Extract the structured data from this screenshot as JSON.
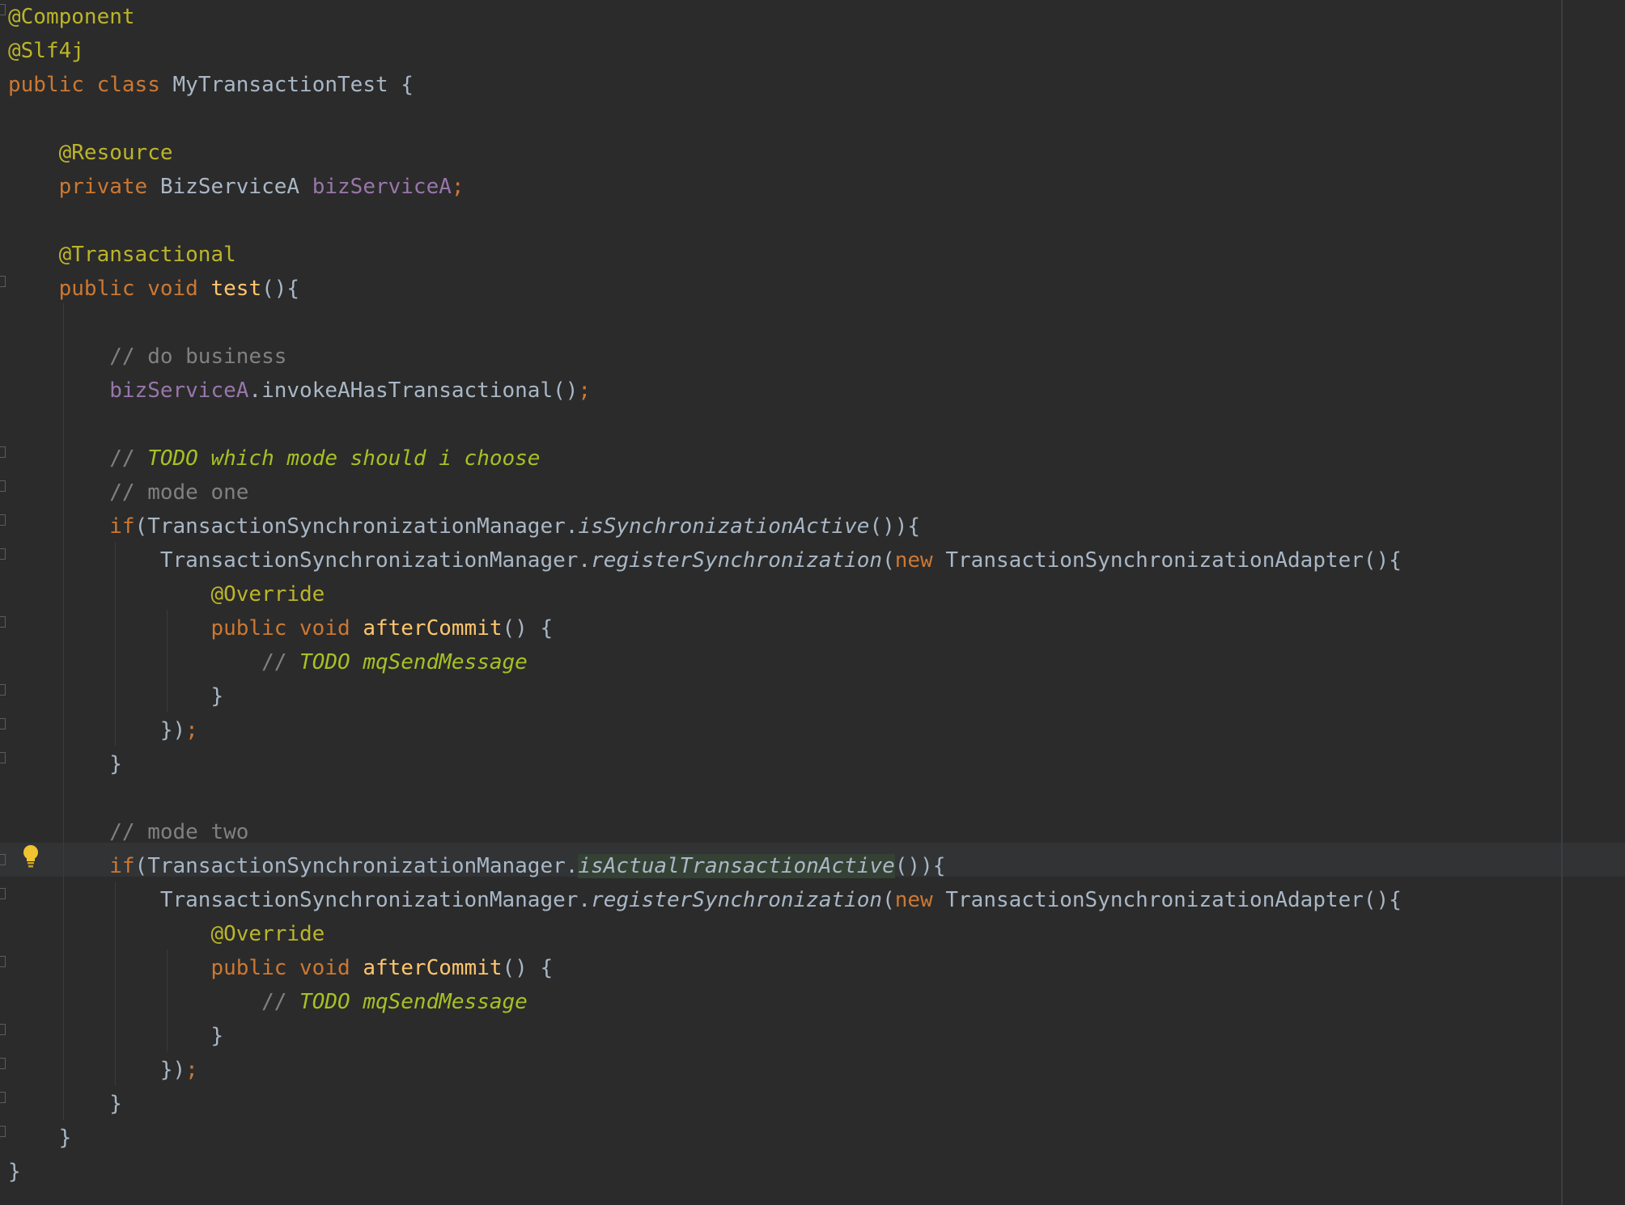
{
  "editor": {
    "language": "java",
    "theme": {
      "background": "#2b2b2b",
      "text": "#a9b7c6",
      "keyword": "#cc7832",
      "annotation": "#bbb529",
      "field": "#9876aa",
      "method_decl": "#ffc66d",
      "comment": "#808080",
      "todo": "#a8c023",
      "current_line": "#313335",
      "usage_highlight": "#344134"
    },
    "gutter_icons": [
      "fold-marker-icon",
      "lightbulb-icon"
    ],
    "lines": [
      {
        "tokens": [
          {
            "t": "@Component",
            "c": "ann"
          }
        ]
      },
      {
        "tokens": [
          {
            "t": "@Slf4j",
            "c": "ann"
          }
        ]
      },
      {
        "tokens": [
          {
            "t": "public",
            "c": "kw"
          },
          {
            "t": " "
          },
          {
            "t": "class",
            "c": "kw"
          },
          {
            "t": " MyTransactionTest {"
          }
        ]
      },
      {
        "tokens": []
      },
      {
        "tokens": [
          {
            "t": "    "
          },
          {
            "t": "@Resource",
            "c": "ann"
          }
        ]
      },
      {
        "tokens": [
          {
            "t": "    "
          },
          {
            "t": "private",
            "c": "kw"
          },
          {
            "t": " BizServiceA "
          },
          {
            "t": "bizServiceA",
            "c": "fld"
          },
          {
            "t": ";",
            "c": "kw"
          }
        ]
      },
      {
        "tokens": []
      },
      {
        "tokens": [
          {
            "t": "    "
          },
          {
            "t": "@Transactional",
            "c": "ann"
          }
        ]
      },
      {
        "tokens": [
          {
            "t": "    "
          },
          {
            "t": "public",
            "c": "kw"
          },
          {
            "t": " "
          },
          {
            "t": "void",
            "c": "kw"
          },
          {
            "t": " "
          },
          {
            "t": "test",
            "c": "fn"
          },
          {
            "t": "(){"
          }
        ]
      },
      {
        "tokens": []
      },
      {
        "tokens": [
          {
            "t": "        "
          },
          {
            "t": "// do business",
            "c": "com"
          }
        ]
      },
      {
        "tokens": [
          {
            "t": "        "
          },
          {
            "t": "bizServiceA",
            "c": "fld"
          },
          {
            "t": ".invokeAHasTransactional()"
          },
          {
            "t": ";",
            "c": "kw"
          }
        ]
      },
      {
        "tokens": []
      },
      {
        "tokens": [
          {
            "t": "        "
          },
          {
            "t": "// ",
            "c": "com"
          },
          {
            "t": "TODO which mode should i choose",
            "c": "todo"
          }
        ]
      },
      {
        "tokens": [
          {
            "t": "        "
          },
          {
            "t": "// mode one",
            "c": "com"
          }
        ]
      },
      {
        "tokens": [
          {
            "t": "        "
          },
          {
            "t": "if",
            "c": "kw"
          },
          {
            "t": "(TransactionSynchronizationManager."
          },
          {
            "t": "isSynchronizationActive",
            "c": "it"
          },
          {
            "t": "()){"
          }
        ]
      },
      {
        "tokens": [
          {
            "t": "            TransactionSynchronizationManager."
          },
          {
            "t": "registerSynchronization",
            "c": "it"
          },
          {
            "t": "("
          },
          {
            "t": "new",
            "c": "kw"
          },
          {
            "t": " TransactionSynchronizationAdapter(){"
          }
        ]
      },
      {
        "tokens": [
          {
            "t": "                "
          },
          {
            "t": "@Override",
            "c": "ann"
          }
        ]
      },
      {
        "tokens": [
          {
            "t": "                "
          },
          {
            "t": "public",
            "c": "kw"
          },
          {
            "t": " "
          },
          {
            "t": "void",
            "c": "kw"
          },
          {
            "t": " "
          },
          {
            "t": "afterCommit",
            "c": "fn"
          },
          {
            "t": "() {"
          }
        ]
      },
      {
        "tokens": [
          {
            "t": "                    "
          },
          {
            "t": "// ",
            "c": "com"
          },
          {
            "t": "TODO mqSendMessage",
            "c": "todo"
          }
        ]
      },
      {
        "tokens": [
          {
            "t": "                }"
          }
        ]
      },
      {
        "tokens": [
          {
            "t": "            })"
          },
          {
            "t": ";",
            "c": "kw"
          }
        ]
      },
      {
        "tokens": [
          {
            "t": "        }"
          }
        ]
      },
      {
        "tokens": []
      },
      {
        "tokens": [
          {
            "t": "        "
          },
          {
            "t": "// mode two",
            "c": "com"
          }
        ]
      },
      {
        "tokens": [
          {
            "t": "        "
          },
          {
            "t": "if",
            "c": "kw"
          },
          {
            "t": "(TransactionSynchronizationManager."
          },
          {
            "t": "isActualTransactionActive",
            "c": "it hl"
          },
          {
            "t": "()){"
          }
        ],
        "current": true
      },
      {
        "tokens": [
          {
            "t": "            TransactionSynchronizationManager."
          },
          {
            "t": "registerSynchronization",
            "c": "it"
          },
          {
            "t": "("
          },
          {
            "t": "new",
            "c": "kw"
          },
          {
            "t": " TransactionSynchronizationAdapter(){"
          }
        ]
      },
      {
        "tokens": [
          {
            "t": "                "
          },
          {
            "t": "@Override",
            "c": "ann"
          }
        ]
      },
      {
        "tokens": [
          {
            "t": "                "
          },
          {
            "t": "public",
            "c": "kw"
          },
          {
            "t": " "
          },
          {
            "t": "void",
            "c": "kw"
          },
          {
            "t": " "
          },
          {
            "t": "afterCommit",
            "c": "fn"
          },
          {
            "t": "() {"
          }
        ]
      },
      {
        "tokens": [
          {
            "t": "                    "
          },
          {
            "t": "// ",
            "c": "com"
          },
          {
            "t": "TODO mqSendMessage",
            "c": "todo"
          }
        ]
      },
      {
        "tokens": [
          {
            "t": "                }"
          }
        ]
      },
      {
        "tokens": [
          {
            "t": "            })"
          },
          {
            "t": ";",
            "c": "kw"
          }
        ]
      },
      {
        "tokens": [
          {
            "t": "        }"
          }
        ]
      },
      {
        "tokens": [
          {
            "t": "    }"
          }
        ]
      },
      {
        "tokens": [
          {
            "t": "}"
          }
        ]
      }
    ]
  }
}
